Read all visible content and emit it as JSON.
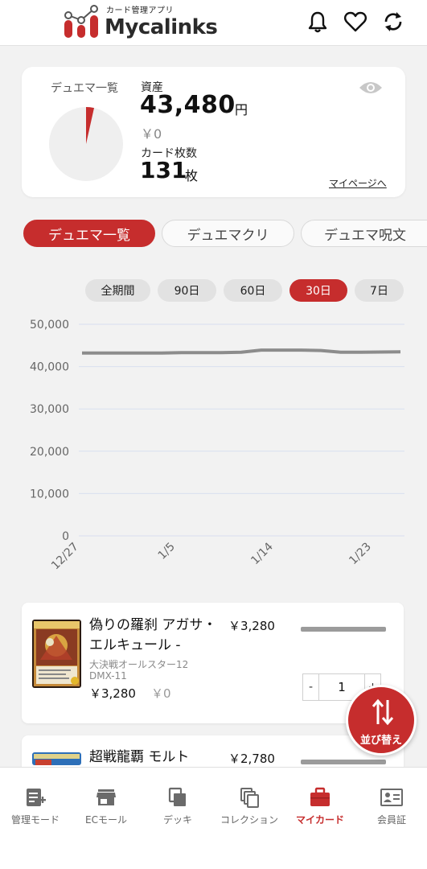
{
  "header": {
    "logo_sub": "カード管理アプリ",
    "logo_main": "Mycalinks",
    "brand_color": "#c62d2d"
  },
  "summary": {
    "collection_label": "デュエマ一覧",
    "asset_label": "資産",
    "asset_value": "43,480",
    "asset_unit": "円",
    "asset_change": "￥0",
    "count_label": "カード枚数",
    "count_value": "131",
    "count_unit": "枚",
    "mypage_link": "マイページへ"
  },
  "category_tabs": [
    {
      "label": "デュエマ一覧",
      "active": true
    },
    {
      "label": "デュエマクリ",
      "active": false
    },
    {
      "label": "デュエマ呪文",
      "active": false
    }
  ],
  "periods": [
    {
      "label": "全期間",
      "active": false
    },
    {
      "label": "90日",
      "active": false
    },
    {
      "label": "60日",
      "active": false
    },
    {
      "label": "30日",
      "active": true
    },
    {
      "label": "7日",
      "active": false
    }
  ],
  "chart_data": {
    "type": "line",
    "ylim": [
      0,
      50000
    ],
    "y_ticks": [
      "0",
      "10,000",
      "20,000",
      "30,000",
      "40,000",
      "50,000"
    ],
    "x_ticks": [
      "12/27",
      "1/5",
      "1/14",
      "1/23"
    ],
    "series": [
      {
        "color": "#8c8c8c",
        "x": [
          "12/24",
          "12/26",
          "12/28",
          "12/30",
          "1/1",
          "1/3",
          "1/5",
          "1/7",
          "1/9",
          "1/11",
          "1/13",
          "1/15",
          "1/17",
          "1/19",
          "1/21",
          "1/23",
          "1/25"
        ],
        "values": [
          43200,
          43200,
          43200,
          43200,
          43200,
          43300,
          43300,
          43300,
          43400,
          43900,
          43900,
          43900,
          43800,
          43400,
          43400,
          43450,
          43480
        ]
      }
    ],
    "grid": true
  },
  "cards": [
    {
      "name": "偽りの羅刹 アガサ・エルキュール -",
      "price": "￥3,280",
      "set": "大決戦オールスター12",
      "code": "DMX-11",
      "sub_price": "￥3,280",
      "sub_change": "￥0",
      "quantity": "1",
      "minus": "-",
      "plus": "+"
    },
    {
      "name": "超戦龍覇 モルト",
      "price": "￥2,780"
    }
  ],
  "sort_button": {
    "label": "並び替え"
  },
  "bottom_nav": [
    {
      "label": "管理モード",
      "icon": "manage-icon",
      "active": false
    },
    {
      "label": "ECモール",
      "icon": "store-icon",
      "active": false
    },
    {
      "label": "デッキ",
      "icon": "deck-icon",
      "active": false
    },
    {
      "label": "コレクション",
      "icon": "collection-icon",
      "active": false
    },
    {
      "label": "マイカード",
      "icon": "briefcase-icon",
      "active": true
    },
    {
      "label": "会員証",
      "icon": "member-card-icon",
      "active": false
    }
  ]
}
